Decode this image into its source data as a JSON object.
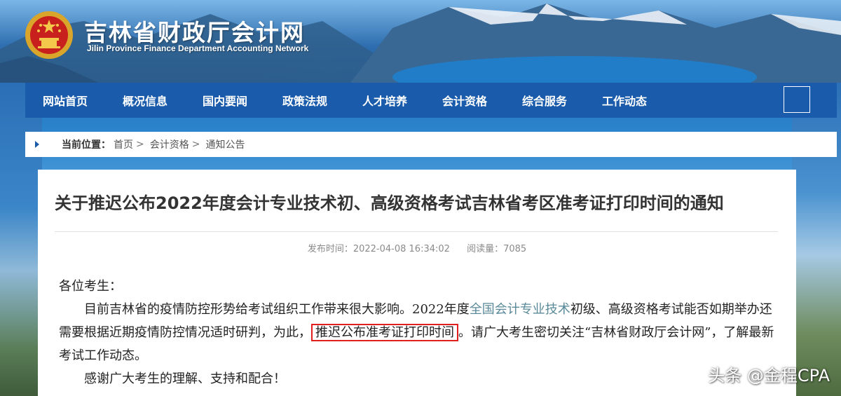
{
  "site": {
    "title": "吉林省财政厅会计网",
    "subtitle": "Jilin Province Finance Department Accounting Network"
  },
  "nav": {
    "items": [
      {
        "label": "网站首页"
      },
      {
        "label": "概况信息"
      },
      {
        "label": "国内要闻"
      },
      {
        "label": "政策法规"
      },
      {
        "label": "人才培养"
      },
      {
        "label": "会计资格"
      },
      {
        "label": "综合服务"
      },
      {
        "label": "工作动态"
      }
    ]
  },
  "breadcrumb": {
    "label": "当前位置：",
    "items": [
      {
        "label": "首页"
      },
      {
        "label": "会计资格"
      },
      {
        "label": "通知公告"
      }
    ],
    "separator": ">"
  },
  "article": {
    "title": "关于推迟公布2022年度会计专业技术初、高级资格考试吉林省考区准考证打印时间的通知",
    "meta": {
      "published_label": "发布时间：",
      "published": "2022-04-08 16:34:02",
      "views_label": "阅读量：",
      "views": "7085"
    },
    "greeting": "各位考生：",
    "para1_a": "目前吉林省的疫情防控形势给考试组织工作带来很大影响。2022年度",
    "para1_blue": "全国会计专业技术",
    "para1_b": "初级、高级资格考试能否如期举办还需要根据近期疫情防控情况适时研判，为此，",
    "para1_boxed": "推迟公布准考证打印时间",
    "para1_c": "。请广大考生密切关注“吉林省财政厅会计网”，了解最新考试工作动态。",
    "para2": "感谢广大考生的理解、支持和配合！"
  },
  "watermark": "头条 @金程CPA",
  "colors": {
    "nav_bg": "#1a5cab",
    "highlight_box": "#e0201c"
  }
}
